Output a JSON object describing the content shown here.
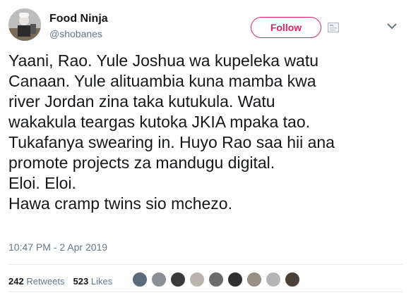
{
  "user": {
    "display_name": "Food Ninja",
    "handle": "@shobanes"
  },
  "follow_label": "Follow",
  "tweet_lines": [
    "Yaani, Rao. Yule Joshua wa kupeleka watu",
    "Canaan. Yule alituambia kuna mamba kwa",
    "river Jordan zina taka kutukula. Watu",
    "wakakula teargas kutoka JKIA mpaka tao.",
    "Tukafanya swearing in. Huyo Rao saa hii ana",
    "promote projects za mandugu digital.",
    "Eloi. Eloi.",
    "Hawa cramp twins sio mchezo."
  ],
  "timestamp": "10:47 PM - 2 Apr 2019",
  "stats": {
    "retweets_count": "242",
    "retweets_label": "Retweets",
    "likes_count": "523",
    "likes_label": "Likes"
  },
  "colors": {
    "follow_accent": "#e0245e",
    "muted_text": "#657786",
    "main_text": "#14171a"
  },
  "liker_avatar_colors": [
    "#5a6a7a",
    "#8a8f96",
    "#3a3a3a",
    "#b9b5ae",
    "#6b6b6b",
    "#2f2f2f",
    "#9a8f85",
    "#b5b5b5",
    "#4a4038"
  ]
}
